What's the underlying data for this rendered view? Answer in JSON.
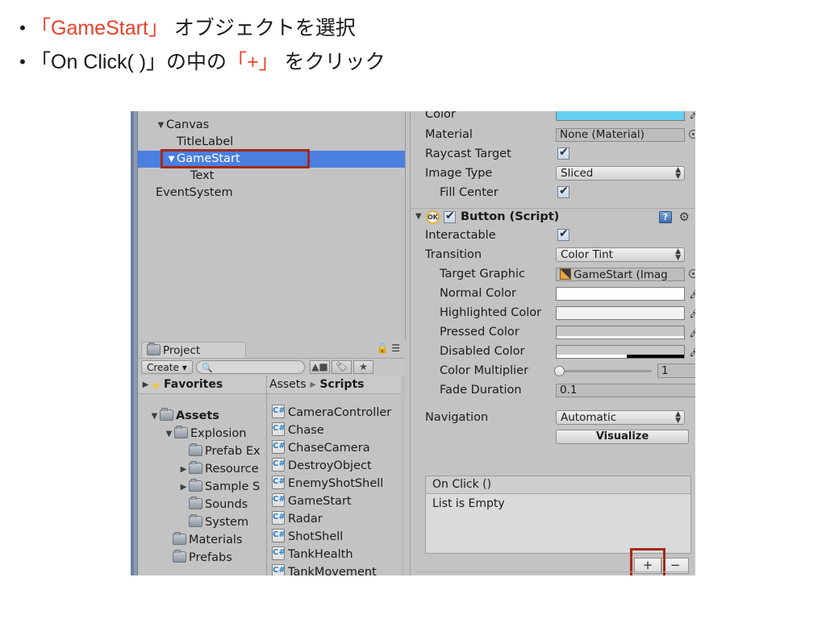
{
  "slide": {
    "bullets": [
      {
        "marker": "•",
        "segments": [
          {
            "text": "「GameStart」",
            "highlight": true
          },
          {
            "text": " オブジェクトを選択",
            "highlight": false
          }
        ]
      },
      {
        "marker": "•",
        "segments": [
          {
            "text": "「On Click( )」の中の",
            "highlight": false
          },
          {
            "text": "「+」",
            "highlight": true
          },
          {
            "text": " をクリック",
            "highlight": false
          }
        ]
      }
    ],
    "highlight_color": "#E8412A",
    "text_color": "#1a1a1a"
  },
  "unity": {
    "hierarchy": {
      "rows": [
        {
          "label": "Canvas",
          "indent": 0,
          "triangle": "▼",
          "selected": false
        },
        {
          "label": "TitleLabel",
          "indent": 1,
          "triangle": "",
          "selected": false
        },
        {
          "label": "GameStart",
          "indent": 1,
          "triangle": "▼",
          "selected": true
        },
        {
          "label": "Text",
          "indent": 2,
          "triangle": "",
          "selected": false
        },
        {
          "label": "EventSystem",
          "indent": 0,
          "triangle": "",
          "selected": false
        }
      ],
      "selection_color": "#4a7fe0",
      "highlight_box_color": "#A32A16"
    },
    "project": {
      "tab_label": "Project",
      "tab_icon": "folder-icon",
      "create_button": "Create",
      "create_arrow": "▾",
      "search_placeholder": "",
      "search_icon": "search-icon",
      "lock_icon": "lock-icon",
      "menu_icon": "hamburger-menu-icon",
      "filter_icons": [
        "shapes-filter-icon",
        "tag-filter-icon",
        "star-filter-icon"
      ],
      "favorites_label": "Favorites",
      "favorites_triangle": "▶",
      "breadcrumb": [
        "Assets",
        "Scripts"
      ],
      "breadcrumb_separator": "▸",
      "tree": [
        {
          "label": "Assets",
          "indent": 0,
          "triangle": "▼",
          "bold": true
        },
        {
          "label": "Explosion",
          "indent": 1,
          "triangle": "▼",
          "bold": false
        },
        {
          "label": "Prefab Ex",
          "indent": 2,
          "triangle": "",
          "bold": false
        },
        {
          "label": "Resource",
          "indent": 2,
          "triangle": "▶",
          "bold": false
        },
        {
          "label": "Sample S",
          "indent": 2,
          "triangle": "▶",
          "bold": false
        },
        {
          "label": "Sounds",
          "indent": 2,
          "triangle": "",
          "bold": false
        },
        {
          "label": "System",
          "indent": 2,
          "triangle": "",
          "bold": false
        },
        {
          "label": "Materials",
          "indent": 1,
          "triangle": "",
          "bold": false
        },
        {
          "label": "Prefabs",
          "indent": 1,
          "triangle": "",
          "bold": false
        }
      ],
      "scripts": [
        "CameraController",
        "Chase",
        "ChaseCamera",
        "DestroyObject",
        "EnemyShotShell",
        "GameStart",
        "Radar",
        "ShotShell",
        "TankHealth",
        "TankMovement"
      ],
      "script_icon": "csharp-script-icon"
    },
    "inspector": {
      "image_component": {
        "rows": [
          {
            "label": "Color",
            "type": "color",
            "value": "#63D2F0",
            "indent": 0
          },
          {
            "label": "Material",
            "type": "object",
            "value": "None (Material)",
            "indent": 0
          },
          {
            "label": "Raycast Target",
            "type": "checkbox",
            "value": "checked",
            "indent": 0
          },
          {
            "label": "Image Type",
            "type": "dropdown",
            "value": "Sliced",
            "indent": 0
          },
          {
            "label": "Fill Center",
            "type": "checkbox",
            "value": "checked",
            "indent": 1
          }
        ]
      },
      "button_component": {
        "title": "Button (Script)",
        "status_icon": "ok-badge-icon",
        "status_text": "OK",
        "enabled": "checked",
        "collapse_triangle": "▼",
        "help_icon": "help-book-icon",
        "help_glyph": "?",
        "gear_icon": "gear-icon",
        "rows": [
          {
            "label": "Interactable",
            "type": "checkbox",
            "value": "checked",
            "indent": 0
          },
          {
            "label": "Transition",
            "type": "dropdown",
            "value": "Color Tint",
            "indent": 0
          },
          {
            "label": "Target Graphic",
            "type": "object",
            "value": "GameStart (Imag",
            "indent": 1,
            "icon": "sprite-icon"
          },
          {
            "label": "Normal Color",
            "type": "color",
            "value": "#FFFFFF",
            "indent": 1
          },
          {
            "label": "Highlighted Color",
            "type": "color",
            "value": "#F2F2F2",
            "indent": 1
          },
          {
            "label": "Pressed Color",
            "type": "color",
            "value": "#C8C8C8",
            "indent": 1
          },
          {
            "label": "Disabled Color",
            "type": "color",
            "value": "#C8C8C8",
            "indent": 1,
            "alpha": "50%"
          },
          {
            "label": "Color Multiplier",
            "type": "slider",
            "value": "1",
            "indent": 1
          },
          {
            "label": "Fade Duration",
            "type": "text",
            "value": "0.1",
            "indent": 1
          }
        ],
        "navigation": {
          "label": "Navigation",
          "value": "Automatic",
          "visualize_button": "Visualize"
        },
        "on_click": {
          "header": "On Click ()",
          "empty_text": "List is Empty",
          "add_button": "+",
          "remove_button": "−",
          "add_button_highlighted": true,
          "highlight_box_color": "#A32A16"
        }
      }
    }
  }
}
